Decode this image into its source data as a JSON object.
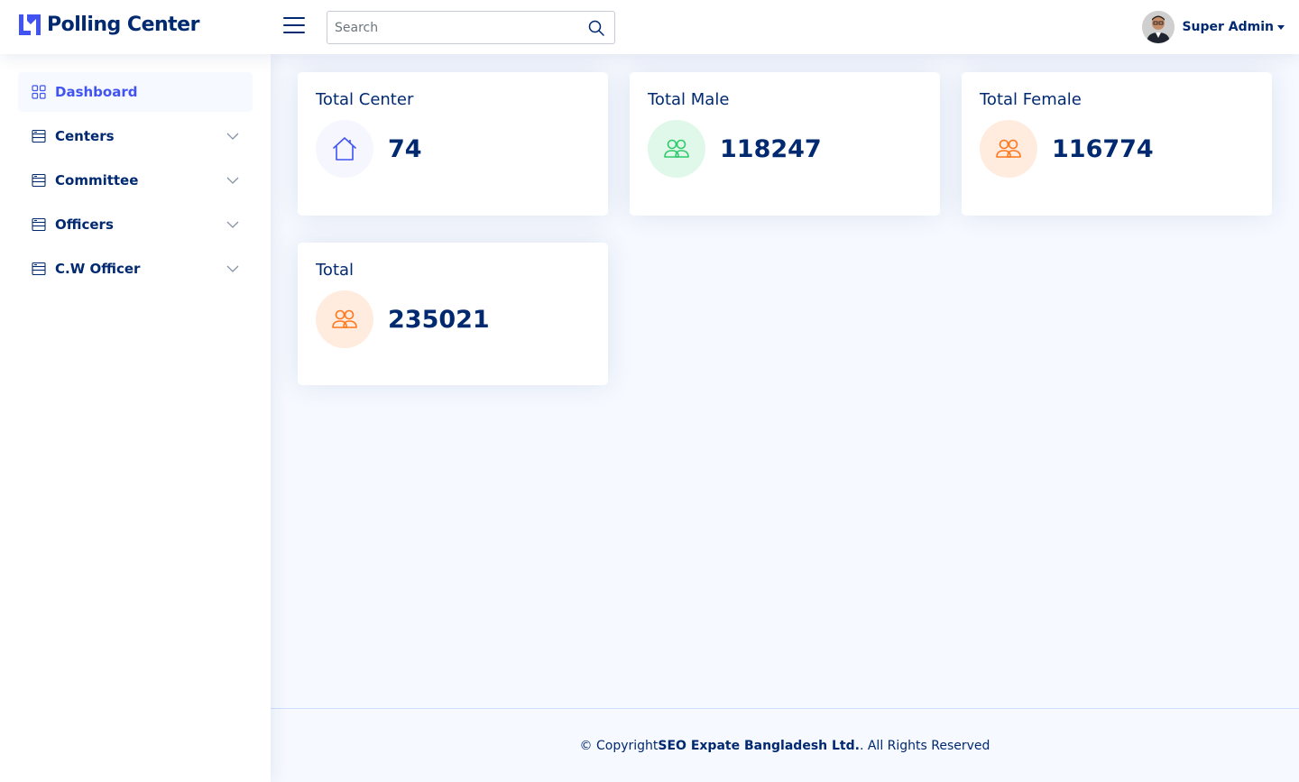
{
  "header": {
    "app_title": "Polling Center",
    "search_placeholder": "Search",
    "user_name": "Super Admin"
  },
  "sidebar": {
    "items": [
      {
        "label": "Dashboard",
        "icon": "grid-icon",
        "active": true
      },
      {
        "label": "Centers",
        "icon": "menu-list-icon",
        "expandable": true
      },
      {
        "label": "Committee",
        "icon": "menu-list-icon",
        "expandable": true
      },
      {
        "label": "Officers",
        "icon": "menu-list-icon",
        "expandable": true
      },
      {
        "label": "C.W Officer",
        "icon": "menu-list-icon",
        "expandable": true
      }
    ]
  },
  "cards": [
    {
      "title": "Total Center",
      "value": "74",
      "icon": "house-icon",
      "icon_color": "#4154f1",
      "bg_color": "#f6f6fe"
    },
    {
      "title": "Total Male",
      "value": "118247",
      "icon": "people-icon",
      "icon_color": "#2eca6a",
      "bg_color": "#e0f8e9"
    },
    {
      "title": "Total Female",
      "value": "116774",
      "icon": "people-icon",
      "icon_color": "#ff771d",
      "bg_color": "#ffecdf"
    },
    {
      "title": "Total",
      "value": "235021",
      "icon": "people-icon",
      "icon_color": "#ff771d",
      "bg_color": "#ffecdf"
    }
  ],
  "footer": {
    "prefix": "© Copyright ",
    "company": "SEO Expate Bangladesh Ltd.",
    "suffix": ". All Rights Reserved"
  },
  "colors": {
    "primary": "#4154f1",
    "text": "#012970",
    "background": "#f6f9ff"
  }
}
